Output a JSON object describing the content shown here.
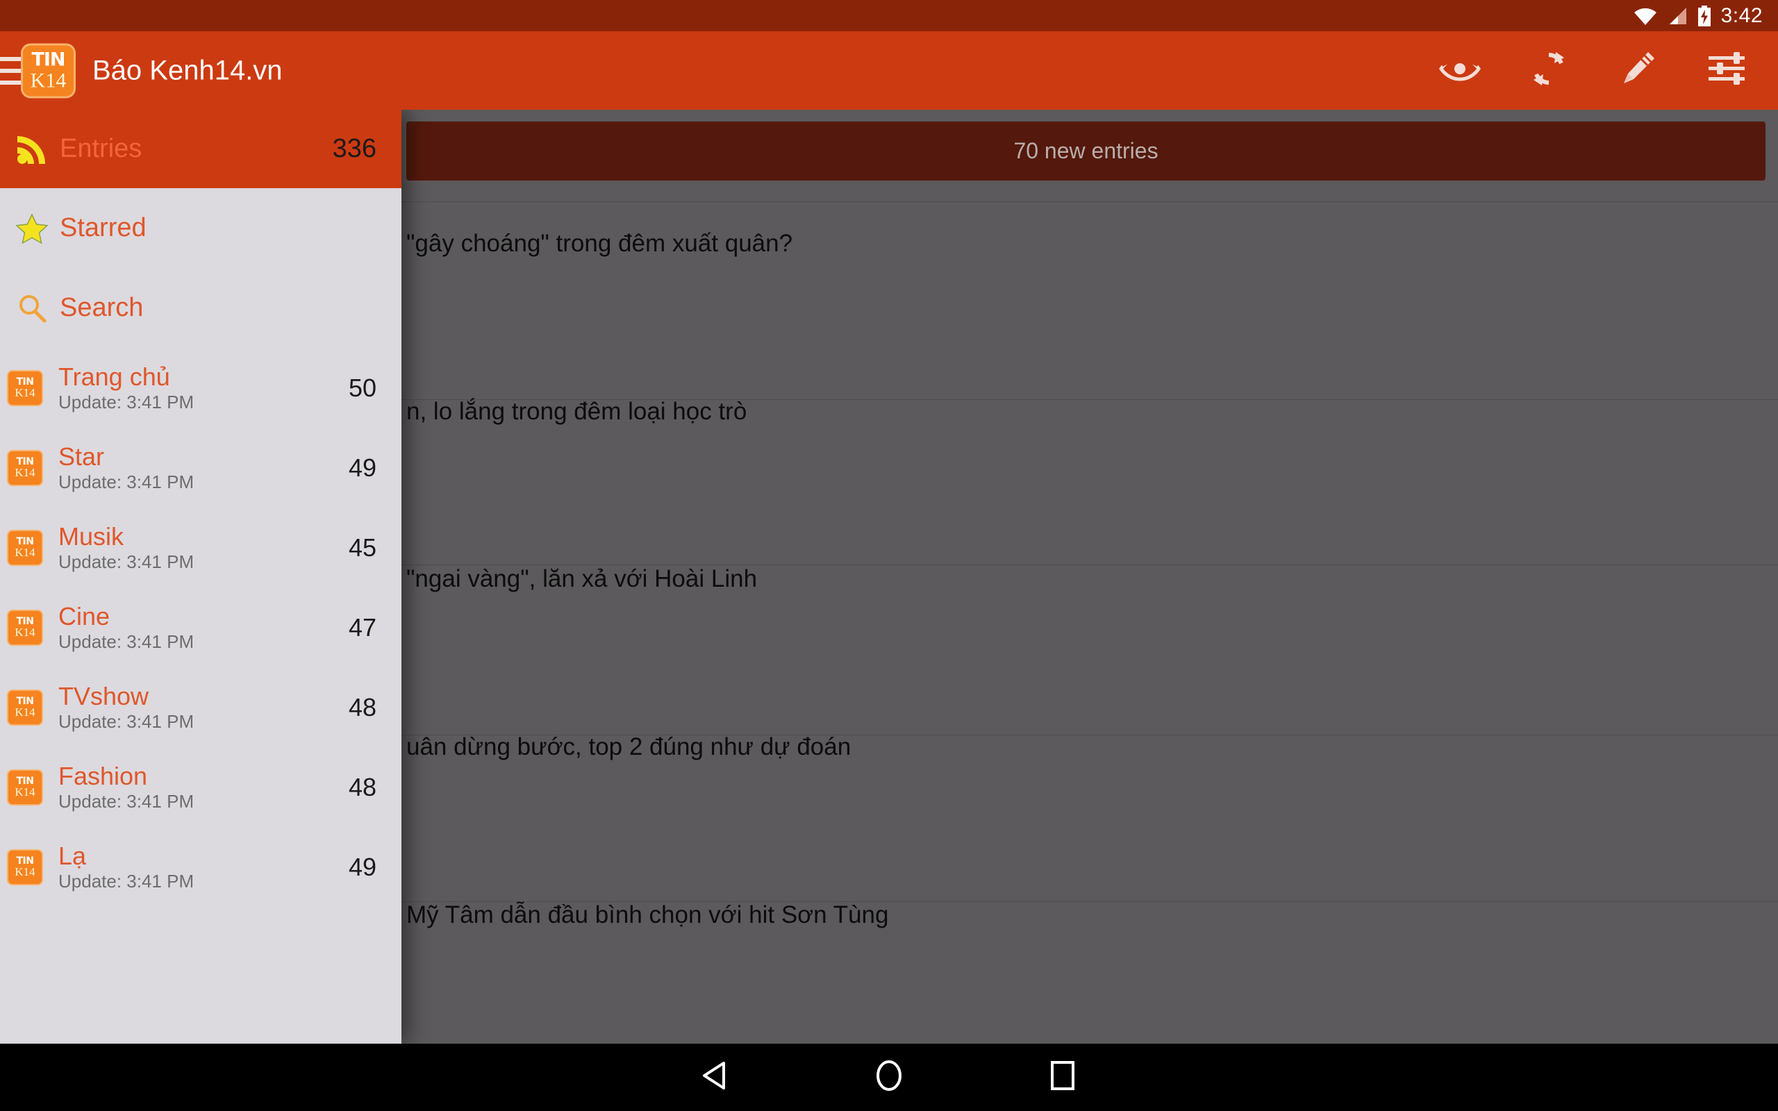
{
  "status_bar": {
    "time": "3:42",
    "icons": [
      "wifi-icon",
      "cellular-signal-icon",
      "battery-charging-icon"
    ]
  },
  "app_bar": {
    "title": "Báo Kenh14.vn",
    "logo": {
      "line1": "TIN",
      "line2": "K14"
    },
    "menu_icon": "hamburger-menu-icon",
    "actions": [
      {
        "name": "mark-read-eye-button",
        "icon": "eye-icon"
      },
      {
        "name": "refresh-button",
        "icon": "refresh-icon"
      },
      {
        "name": "edit-button",
        "icon": "pencil-icon"
      },
      {
        "name": "settings-button",
        "icon": "sliders-icon"
      }
    ]
  },
  "drawer": {
    "header": {
      "icon": "rss-icon",
      "label": "Entries",
      "count": "336"
    },
    "shortcuts": [
      {
        "icon": "star-icon",
        "label": "Starred"
      },
      {
        "icon": "search-icon",
        "label": "Search"
      }
    ],
    "feeds": [
      {
        "title": "Trang chủ",
        "subtitle": "Update: 3:41 PM",
        "count": "50"
      },
      {
        "title": "Star",
        "subtitle": "Update: 3:41 PM",
        "count": "49"
      },
      {
        "title": "Musik",
        "subtitle": "Update: 3:41 PM",
        "count": "45"
      },
      {
        "title": "Cine",
        "subtitle": "Update: 3:41 PM",
        "count": "47"
      },
      {
        "title": "TVshow",
        "subtitle": "Update: 3:41 PM",
        "count": "48"
      },
      {
        "title": "Fashion",
        "subtitle": "Update: 3:41 PM",
        "count": "48"
      },
      {
        "title": "Lạ",
        "subtitle": "Update: 3:41 PM",
        "count": "49"
      }
    ],
    "feed_icon": {
      "line1": "TIN",
      "line2": "K14"
    }
  },
  "content": {
    "new_entries_banner": "70 new entries",
    "articles": [
      {
        "title": "\"gây choáng\" trong đêm xuất quân?"
      },
      {
        "title": "n, lo lắng trong đêm loại học trò"
      },
      {
        "title": "\"ngai vàng\", lăn xả với Hoài Linh"
      },
      {
        "title": "uân dừng bước, top 2 đúng như dự đoán"
      },
      {
        "title": "Mỹ Tâm dẫn đầu bình chọn với hit Sơn Tùng"
      }
    ]
  },
  "nav_bar": {
    "buttons": [
      {
        "name": "back-button",
        "icon": "triangle-back-icon"
      },
      {
        "name": "home-button",
        "icon": "circle-home-icon"
      },
      {
        "name": "recents-button",
        "icon": "square-recents-icon"
      }
    ]
  },
  "colors": {
    "primary": "#cc3a11",
    "primary_dark": "#8a2409",
    "accent": "#e0562b",
    "drawer_bg": "#dcdade",
    "scrim_bg": "#5c5a5c",
    "banner_bg": "#54190c",
    "logo_orange": "#f5831f"
  }
}
